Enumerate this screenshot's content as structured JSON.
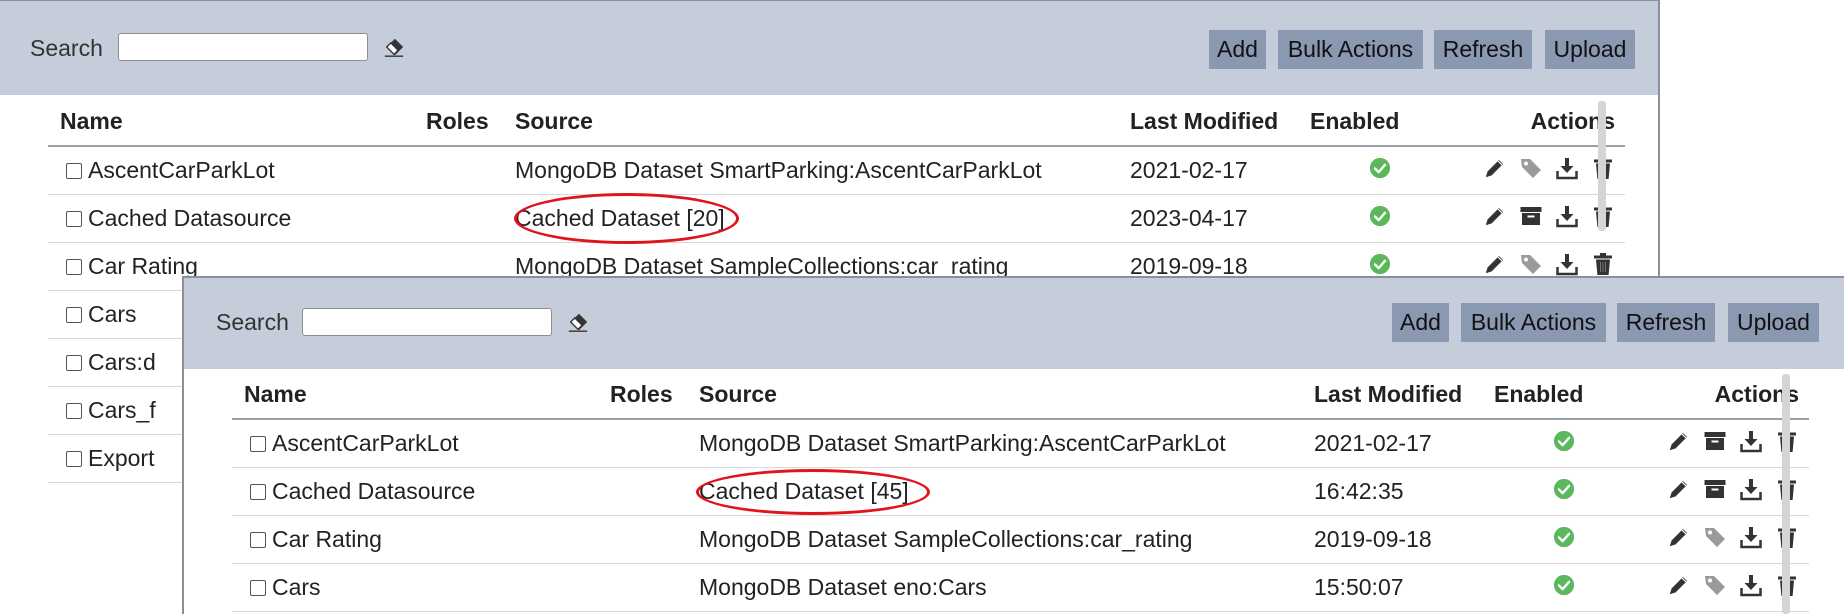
{
  "back": {
    "search_label": "Search",
    "search_value": "",
    "buttons": {
      "add": "Add",
      "bulk": "Bulk Actions",
      "refresh": "Refresh",
      "upload": "Upload"
    },
    "columns": {
      "name": "Name",
      "roles": "Roles",
      "source": "Source",
      "modified": "Last Modified",
      "enabled": "Enabled",
      "actions": "Actions"
    },
    "rows": [
      {
        "name": "AscentCarParkLot",
        "source": "MongoDB Dataset SmartParking:AscentCarParkLot",
        "modified": "2021-02-17"
      },
      {
        "name": "Cached Datasource",
        "source": "Cached Dataset [20]",
        "modified": "2023-04-17"
      },
      {
        "name": "Car Rating",
        "source": "MongoDB Dataset SampleCollections:car_rating",
        "modified": "2019-09-18"
      },
      {
        "name": "Cars",
        "source": "",
        "modified": ""
      },
      {
        "name": "Cars:d",
        "source": "",
        "modified": ""
      },
      {
        "name": "Cars_f",
        "source": "",
        "modified": ""
      },
      {
        "name": "Export",
        "source": "",
        "modified": ""
      }
    ]
  },
  "front": {
    "search_label": "Search",
    "search_value": "",
    "buttons": {
      "add": "Add",
      "bulk": "Bulk Actions",
      "refresh": "Refresh",
      "upload": "Upload"
    },
    "columns": {
      "name": "Name",
      "roles": "Roles",
      "source": "Source",
      "modified": "Last Modified",
      "enabled": "Enabled",
      "actions": "Actions"
    },
    "rows": [
      {
        "name": "AscentCarParkLot",
        "source": "MongoDB Dataset SmartParking:AscentCarParkLot",
        "modified": "2021-02-17"
      },
      {
        "name": "Cached Datasource",
        "source": "Cached Dataset [45]",
        "modified": "16:42:35"
      },
      {
        "name": "Car Rating",
        "source": "MongoDB Dataset SampleCollections:car_rating",
        "modified": "2019-09-18"
      },
      {
        "name": "Cars",
        "source": "MongoDB Dataset eno:Cars",
        "modified": "15:50:07"
      }
    ]
  },
  "colors": {
    "toolbar_bg": "#c5ccda",
    "button_bg": "#8a98b2",
    "enabled_green": "#5cb85c",
    "highlight_red": "#e0141c"
  }
}
